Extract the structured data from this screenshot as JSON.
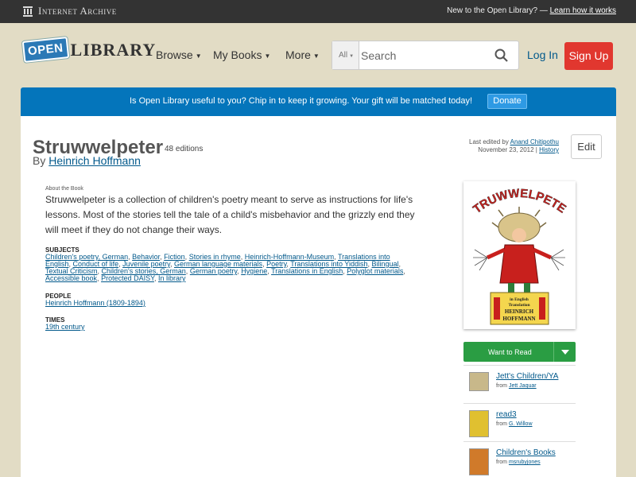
{
  "ia_bar": {
    "logo_text": "Internet Archive",
    "promo_text": "New to the Open Library? —",
    "promo_link": "Learn how it works"
  },
  "header": {
    "logo_open": "OPEN",
    "logo_library": "LIBRARY",
    "nav": [
      {
        "label": "Browse"
      },
      {
        "label": "My Books"
      },
      {
        "label": "More"
      }
    ],
    "search": {
      "scope": "All",
      "placeholder": "Search"
    },
    "login_label": "Log In",
    "signup_label": "Sign Up"
  },
  "donate_banner": {
    "text": "Is Open Library useful to you? Chip in to keep it growing. Your gift will be matched today!",
    "button_label": "Donate"
  },
  "work": {
    "title": "Struwwelpeter",
    "editions": "48 editions",
    "by": "By",
    "author": "Heinrich Hoffmann",
    "last_edited_label": "Last edited by",
    "last_edited_user": "Anand Chitipothu",
    "last_edited_date": "November 23, 2012 |",
    "history_label": "History",
    "edit_label": "Edit",
    "about_label": "About the Book",
    "description": "Struwwelpeter is a collection of children's poetry meant to serve as instructions for life's lessons. Most of the stories tell the tale of a child's misbehavior and the grizzly end they will meet if they do not change their ways.",
    "subjects_label": "SUBJECTS",
    "subjects": [
      "Children's poetry, German",
      "Behavior",
      "Fiction",
      "Stories in rhyme",
      "Heinrich-Hoffmann-Museum",
      "Translations into English",
      "Conduct of life",
      "Juvenile poetry",
      "German language materials",
      "Poetry",
      "Translations into Yiddish",
      "Bilingual",
      "Textual Criticism",
      "Children's stories, German",
      "German poetry",
      "Hygiene",
      "Translations in English",
      "Polyglot materials",
      "Accessible book",
      "Protected DAISY",
      "In library"
    ],
    "people_label": "PEOPLE",
    "people": [
      "Heinrich Hoffmann (1809-1894)"
    ],
    "times_label": "TIMES",
    "times": [
      "19th century"
    ]
  },
  "cover": {
    "title_text": "STRUWWELPETER",
    "plinth_line1": "in English",
    "plinth_line2": "Translation",
    "plinth_line3": "HEINRICH",
    "plinth_line4": "HOFFMANN"
  },
  "want_to_read": {
    "label": "Want to Read"
  },
  "lists": [
    {
      "name": "Jett's Children/YA",
      "from_label": "from",
      "owner": "Jett Jaquar",
      "thumb_color": "#c8b88a"
    },
    {
      "name": "read3",
      "from_label": "from",
      "owner": "G. Willow",
      "thumb_color": "#e0c030"
    },
    {
      "name": "Children's Books",
      "from_label": "from",
      "owner": "msrubyjones",
      "thumb_color": "#d07a2a"
    }
  ]
}
